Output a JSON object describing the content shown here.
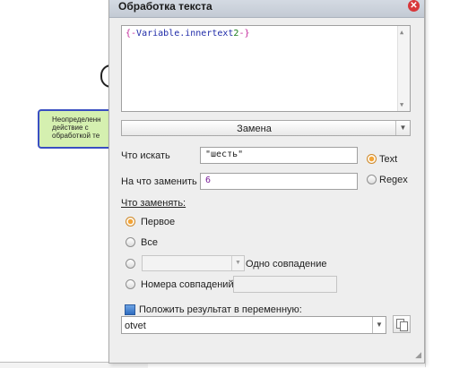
{
  "background": {
    "node_lines": [
      "Неопределенн",
      "действие с",
      "обработкой те"
    ]
  },
  "dialog": {
    "title": "Обработка текста",
    "close_glyph": "✕",
    "code": {
      "open": "{-",
      "variable": "Variable.innertext",
      "number": "2",
      "close": "-}"
    },
    "mode": "Замена",
    "find_label": "Что искать",
    "find_value": "\"шесть\"",
    "replace_label": "На что заменить",
    "replace_value": "6",
    "type_text": "Text",
    "type_regex": "Regex",
    "what_replace_label": "Что заменять:",
    "opt_first": "Первое",
    "opt_all": "Все",
    "opt_one_match": "Одно совпадение",
    "opt_match_numbers": "Номера совпадений",
    "put_result_label": "Положить результат в переменную:",
    "result_var": "otvet"
  },
  "colors": {
    "selected_radio": "#f3a437",
    "code_brace": "#c32a9b",
    "code_variable": "#1e2aa8",
    "code_number": "#1b7e1b",
    "node_fill": "#d5f0b0",
    "node_border": "#3a4fc2"
  }
}
